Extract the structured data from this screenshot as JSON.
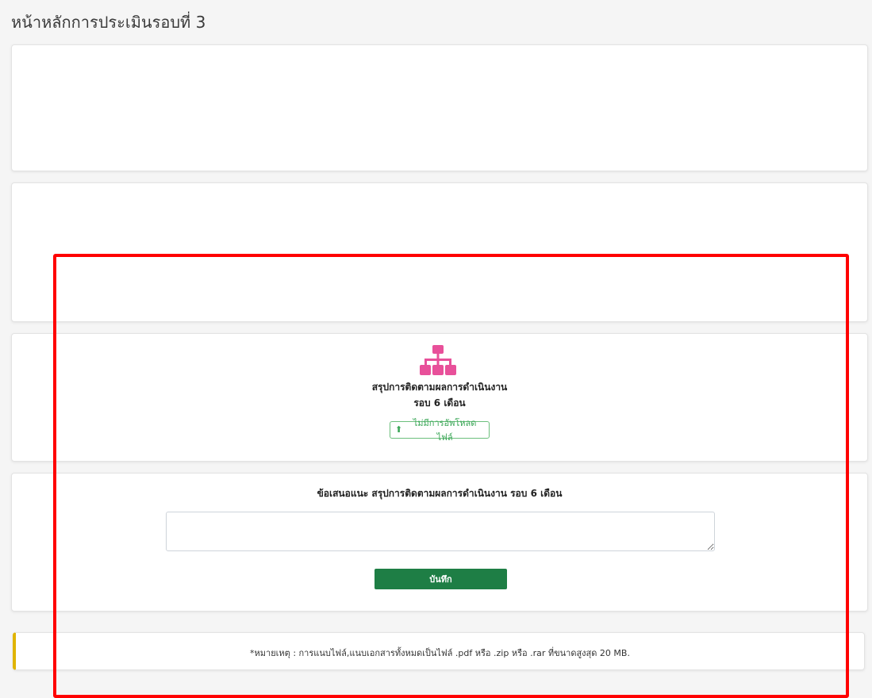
{
  "page": {
    "title": "หน้าหลักการประเมินรอบที่ 3"
  },
  "summary_card": {
    "icon": "sitemap-icon",
    "icon_color": "#e8509a",
    "title": "สรุปการติดตามผลการดำเนินงาน",
    "subtitle": "รอบ 6 เดือน",
    "upload_button": {
      "icon": "upload-icon",
      "label": "ไม่มีการอัพโหลดไฟล์"
    }
  },
  "suggestion_card": {
    "title": "ข้อเสนอแนะ สรุปการติดตามผลการดำเนินงาน รอบ 6 เดือน",
    "textarea_value": "",
    "save_label": "บันทึก"
  },
  "note": {
    "text": "*หมายเหตุ : การแนบไฟล์,แนบเอกสารทั้งหมดเป็นไฟล์ .pdf หรือ .zip หรือ .rar ที่ขนาดสูงสุด 20 MB."
  },
  "colors": {
    "highlight": "#ff0000",
    "save_button": "#1e7e45",
    "upload_accent": "#3aa657",
    "note_accent": "#e0b400"
  }
}
